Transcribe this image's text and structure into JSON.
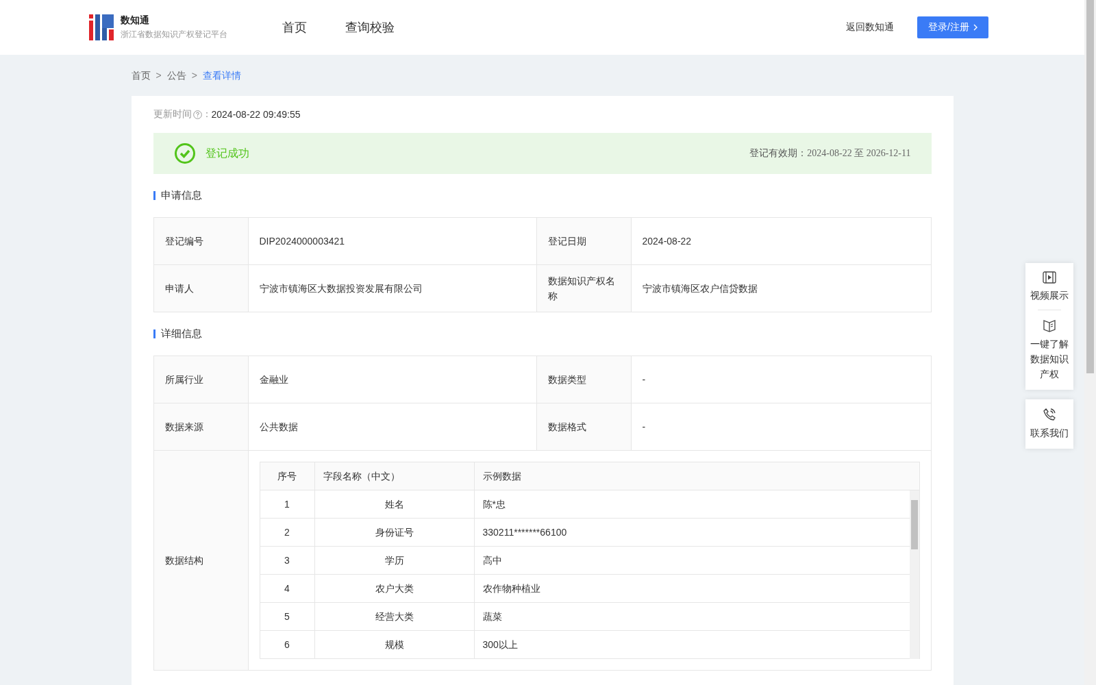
{
  "header": {
    "logo_title": "数知通",
    "logo_subtitle": "浙江省数据知识产权登记平台",
    "nav": [
      {
        "label": "首页"
      },
      {
        "label": "查询校验"
      }
    ],
    "back_link": "返回数知通",
    "login_button": "登录/注册"
  },
  "breadcrumb": [
    {
      "label": "首页",
      "selected": false
    },
    {
      "label": "公告",
      "selected": false
    },
    {
      "label": "查看详情",
      "selected": true
    }
  ],
  "breadcrumb_separator": ">",
  "update": {
    "label": "更新时间",
    "colon": "：",
    "value": "2024-08-22 09:49:55"
  },
  "status": {
    "text": "登记成功",
    "validity_label": "登记有效期：",
    "validity_value": "2024-08-22 至 2026-12-11"
  },
  "sections": [
    {
      "title": "申请信息",
      "rows": [
        [
          {
            "label": "登记编号",
            "value": "DIP2024000003421"
          },
          {
            "label": "登记日期",
            "value": "2024-08-22"
          }
        ],
        [
          {
            "label": "申请人",
            "value": "宁波市镇海区大数据投资发展有限公司"
          },
          {
            "label": "数据知识产权名称",
            "value": "宁波市镇海区农户信贷数据"
          }
        ]
      ]
    },
    {
      "title": "详细信息",
      "rows": [
        [
          {
            "label": "所属行业",
            "value": "金融业"
          },
          {
            "label": "数据类型",
            "value": "-"
          }
        ],
        [
          {
            "label": "数据来源",
            "value": "公共数据"
          },
          {
            "label": "数据格式",
            "value": "-"
          }
        ]
      ],
      "structure": {
        "label": "数据结构",
        "columns": [
          "序号",
          "字段名称（中文）",
          "示例数据"
        ],
        "rows": [
          [
            "1",
            "姓名",
            "陈*忠"
          ],
          [
            "2",
            "身份证号",
            "330211*******66100"
          ],
          [
            "3",
            "学历",
            "高中"
          ],
          [
            "4",
            "农户大类",
            "农作物种植业"
          ],
          [
            "5",
            "经营大类",
            "蔬菜"
          ],
          [
            "6",
            "规模",
            "300以上"
          ]
        ]
      }
    }
  ],
  "side_panel": [
    {
      "kind": "video",
      "label": "视频展示"
    },
    {
      "kind": "book",
      "label": "一键了解数据知识产权"
    },
    {
      "kind": "phone",
      "label": "联系我们"
    }
  ]
}
